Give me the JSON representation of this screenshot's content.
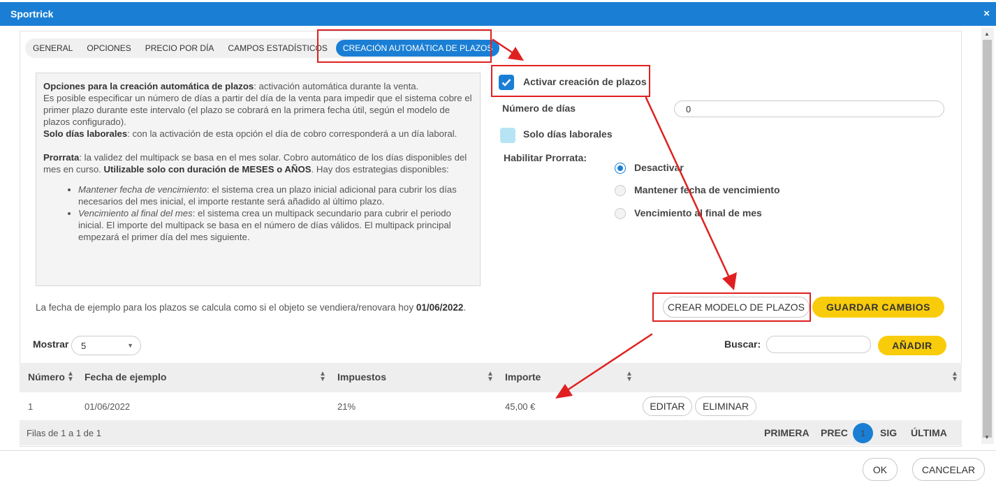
{
  "window": {
    "title": "Sportrick",
    "close_glyph": "×"
  },
  "tabs": [
    {
      "label": "GENERAL"
    },
    {
      "label": "OPCIONES"
    },
    {
      "label": "PRECIO POR DÍA"
    },
    {
      "label": "CAMPOS ESTADÍSTICOS"
    },
    {
      "label": "CREACIÓN AUTOMÁTICA DE PLAZOS"
    }
  ],
  "info": {
    "p1_bold": "Opciones para la creación automática de plazos",
    "p1_rest": ": activación automática durante la venta.",
    "p2": "Es posible especificar un número de días a partir del día de la venta para impedir que el sistema cobre el primer plazo durante este intervalo (el plazo se cobrará en la primera fecha útil, según el modelo de plazos configurado).",
    "p3_bold": "Solo días laborales",
    "p3_rest": ": con la activación de esta opción el día de cobro corresponderá a un día laboral.",
    "p4_bold": "Prorrata",
    "p4_rest1": ": la validez del multipack se basa en el mes solar. Cobro automático de los días disponibles del mes en curso. ",
    "p4_bold2": "Utilizable solo con duración de MESES o AÑOS",
    "p4_rest2": ". Hay dos estrategias disponibles:",
    "li1_italic": "Mantener fecha de vencimiento",
    "li1_rest": ": el sistema crea un plazo inicial adicional para cubrir los días necesarios del mes inicial, el importe restante será añadido al último plazo.",
    "li2_italic": "Vencimiento al final del mes",
    "li2_rest": ": el sistema crea un multipack secundario para cubrir el periodo inicial. El importe del multipack se basa en el número de días válidos. El multipack principal empezará el primer día del mes siguiente."
  },
  "form": {
    "activate_label": "Activar creación de plazos",
    "activate_checked": true,
    "days_label": "Número de días",
    "days_value": "0",
    "workdays_label": "Solo días laborales",
    "workdays_checked": false,
    "prorate_label": "Habilitar Prorrata:",
    "prorate_options": [
      {
        "label": "Desactivar",
        "selected": true
      },
      {
        "label": "Mantener fecha de vencimiento",
        "selected": false
      },
      {
        "label": "Vencimiento al final de mes",
        "selected": false
      }
    ]
  },
  "note": {
    "text": "La fecha de ejemplo para los plazos se calcula como si el objeto se vendiera/renovara hoy ",
    "date": "01/06/2022",
    "suffix": "."
  },
  "actions": {
    "create_model": "CREAR MODELO DE PLAZOS",
    "save": "GUARDAR CAMBIOS",
    "add": "AÑADIR"
  },
  "table_controls": {
    "show_label": "Mostrar",
    "page_size": "5",
    "search_label": "Buscar:",
    "search_value": ""
  },
  "table": {
    "columns": [
      "Número",
      "Fecha de ejemplo",
      "Impuestos",
      "Importe",
      ""
    ],
    "rows": [
      {
        "numero": "1",
        "fecha": "01/06/2022",
        "impuestos": "21%",
        "importe": "45,00 €",
        "edit": "EDITAR",
        "delete": "ELIMINAR"
      }
    ],
    "summary": "Filas de 1 a 1 de 1",
    "pagination": {
      "first": "PRIMERA",
      "prev": "PREC",
      "current": "1",
      "next": "SIG",
      "last": "ÚLTIMA"
    }
  },
  "dialog_buttons": {
    "ok": "OK",
    "cancel": "CANCELAR"
  },
  "colors": {
    "primary": "#1a7fd4",
    "accent_yellow": "#f9cc0b",
    "annotation_red": "#e02020"
  }
}
